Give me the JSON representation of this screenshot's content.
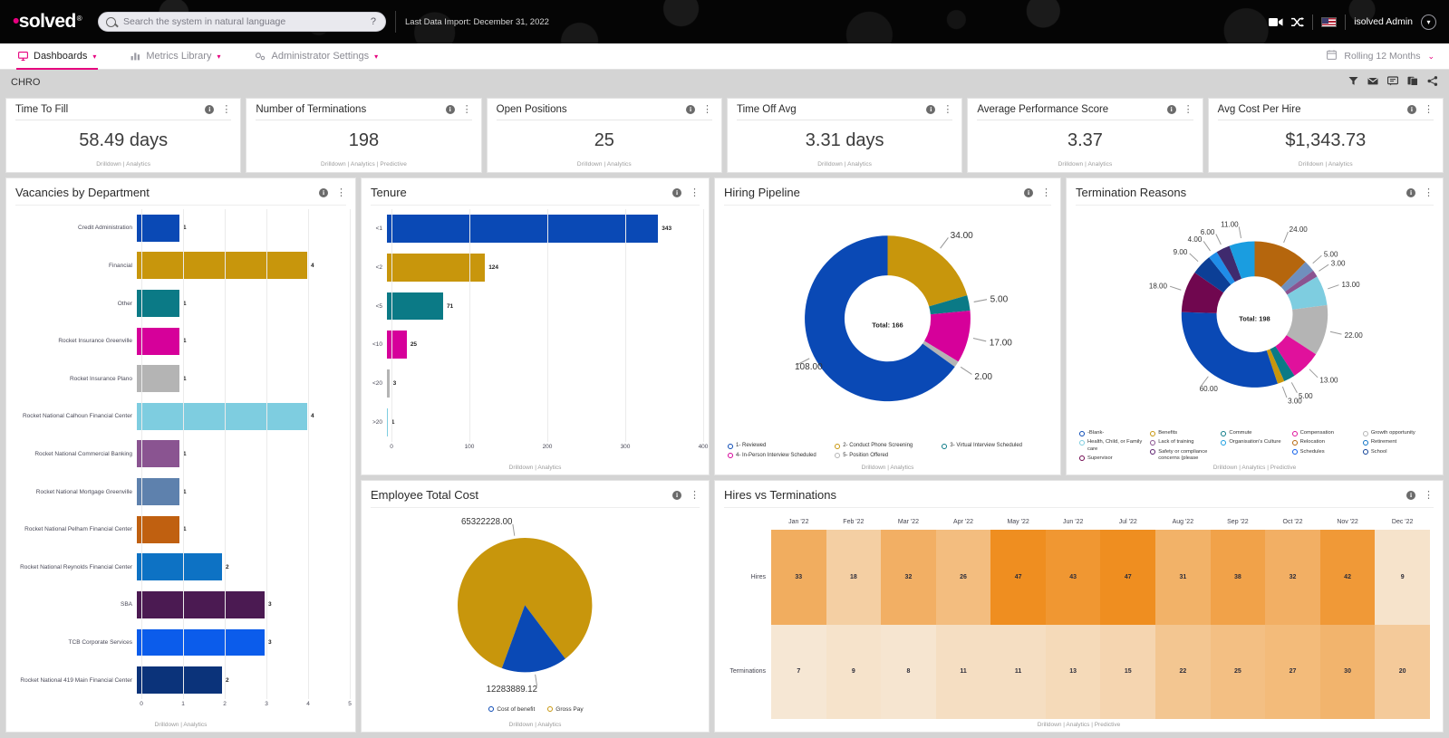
{
  "topbar": {
    "logo_text": "solved",
    "search_placeholder": "Search the system in natural language",
    "search_value": "",
    "help_glyph": "?",
    "last_import": "Last Data Import: December 31, 2022",
    "admin_label": "isolved Admin"
  },
  "nav": {
    "items": [
      {
        "label": "Dashboards",
        "icon": "monitor-icon",
        "active": true
      },
      {
        "label": "Metrics Library",
        "icon": "bar-chart-icon",
        "active": false
      },
      {
        "label": "Administrator Settings",
        "icon": "gears-icon",
        "active": false
      }
    ],
    "date_range": "Rolling 12 Months",
    "date_icon": "calendar-icon"
  },
  "dashboard": {
    "name": "CHRO",
    "toolbar_icons": [
      "filter-icon",
      "mail-icon",
      "comment-icon",
      "copy-icon",
      "share-icon"
    ]
  },
  "kpi_footer": {
    "drilldown": "Drilldown",
    "analytics": "Analytics",
    "predictive": "Predictive"
  },
  "kpis": [
    {
      "title": "Time To Fill",
      "value": "58.49 days",
      "links": "Drilldown | Analytics"
    },
    {
      "title": "Number of Terminations",
      "value": "198",
      "links": "Drilldown | Analytics | Predictive"
    },
    {
      "title": "Open Positions",
      "value": "25",
      "links": "Drilldown | Analytics"
    },
    {
      "title": "Time Off Avg",
      "value": "3.31 days",
      "links": "Drilldown | Analytics"
    },
    {
      "title": "Average Performance Score",
      "value": "3.37",
      "links": "Drilldown | Analytics"
    },
    {
      "title": "Avg Cost Per Hire",
      "value": "$1,343.73",
      "links": "Drilldown | Analytics"
    }
  ],
  "panels": {
    "vacancies": {
      "title": "Vacancies by Department",
      "links": "Drilldown | Analytics"
    },
    "tenure": {
      "title": "Tenure",
      "links": "Drilldown | Analytics"
    },
    "pipeline": {
      "title": "Hiring Pipeline",
      "links": "Drilldown | Analytics"
    },
    "terminations": {
      "title": "Termination Reasons",
      "links": "Drilldown | Analytics | Predictive"
    },
    "cost": {
      "title": "Employee Total Cost",
      "links": "Drilldown | Analytics"
    },
    "hires": {
      "title": "Hires vs Terminations",
      "links": "Drilldown | Analytics | Predictive"
    }
  },
  "chart_data": [
    {
      "type": "bar",
      "id": "vacancies-by-department",
      "title": "Vacancies by Department",
      "orientation": "horizontal",
      "categories": [
        "Credit Administration",
        "Financial",
        "Other",
        "Rocket Insurance Greenville",
        "Rocket Insurance Plano",
        "Rocket National Calhoun Financial Center",
        "Rocket National Commercial Banking",
        "Rocket National Mortgage Greenville",
        "Rocket National Pelham Financial Center",
        "Rocket National Reynolds Financial Center",
        "SBA",
        "TCB Corporate Services",
        "Rocket National 419 Main Financial Center"
      ],
      "values": [
        1,
        4,
        1,
        1,
        1,
        4,
        1,
        1,
        1,
        2,
        3,
        3,
        2
      ],
      "colors": [
        "#0a49b5",
        "#c8960c",
        "#0b7a86",
        "#d6009a",
        "#b4b4b4",
        "#7ecde0",
        "#8a5491",
        "#5e81ad",
        "#c06010",
        "#0d72c4",
        "#4b1a52",
        "#0b5ceb",
        "#0b337a"
      ],
      "xlabel": "",
      "ylabel": "",
      "xticks": [
        0,
        1,
        2,
        3,
        4,
        5
      ],
      "xlim": [
        0,
        5
      ],
      "grid": true
    },
    {
      "type": "bar",
      "id": "tenure",
      "title": "Tenure",
      "orientation": "horizontal",
      "categories": [
        "<1",
        "<2",
        "<5",
        "<10",
        "<20",
        ">20"
      ],
      "values": [
        343,
        124,
        71,
        25,
        3,
        1
      ],
      "colors": [
        "#0a49b5",
        "#c8960c",
        "#0b7a86",
        "#d6009a",
        "#b4b4b4",
        "#7ecde0"
      ],
      "xticks": [
        0,
        100,
        200,
        300,
        400
      ],
      "xlim": [
        0,
        400
      ],
      "grid": true
    },
    {
      "type": "pie",
      "variant": "donut",
      "id": "hiring-pipeline",
      "title": "Hiring Pipeline",
      "center_label": "Total: 166",
      "total": 166,
      "labels": [
        "1- Reviewed",
        "2- Conduct Phone Screening",
        "3- Virtual Interview Scheduled",
        "4- In-Person Interview Scheduled",
        "5- Position Offered"
      ],
      "values": [
        108.0,
        34.0,
        5.0,
        17.0,
        2.0
      ],
      "value_labels": [
        "108.00",
        "34.00",
        "5.00",
        "17.00",
        "2.00"
      ],
      "colors": [
        "#0a49b5",
        "#c8960c",
        "#0b7a86",
        "#d6009a",
        "#b4b4b4"
      ],
      "legend_position": "bottom"
    },
    {
      "type": "pie",
      "variant": "donut",
      "id": "termination-reasons",
      "title": "Termination Reasons",
      "center_label": "Total: 198",
      "total": 198,
      "labels": [
        "-Blank-",
        "Benefits",
        "Commute",
        "Compensation",
        "Growth opportunity",
        "Health, Child, or Family care",
        "Lack of training",
        "Organisation's Culture",
        "Relocation",
        "Retirement",
        "Safety or compliance concerns (please specify)",
        "Schedules",
        "School",
        "Supervisor"
      ],
      "values": [
        24,
        5,
        3,
        13,
        22,
        13,
        5,
        3,
        60,
        18,
        9,
        4,
        6,
        11
      ],
      "value_labels": [
        "24.00",
        "5.00",
        "3.00",
        "13.00",
        "22.00",
        "13.00",
        "5.00",
        "3.00",
        "60.00",
        "18.00",
        "9.00",
        "4.00",
        "6.00",
        "11.00"
      ],
      "colors": [
        "#b5660d",
        "#6f8fbd",
        "#8a5491",
        "#7ecde0",
        "#b4b4b4",
        "#e0119c",
        "#0b7a86",
        "#c8960c",
        "#0a49b5",
        "#70074f",
        "#0c3f96",
        "#1f8de8",
        "#3f2a6e",
        "#1a9de0"
      ],
      "legend_position": "bottom"
    },
    {
      "type": "pie",
      "id": "employee-total-cost",
      "title": "Employee Total Cost",
      "labels": [
        "Cost of benefit",
        "Gross Pay"
      ],
      "values": [
        12283889.12,
        65322228.0
      ],
      "value_labels": [
        "12283889.12",
        "65322228.00"
      ],
      "colors": [
        "#0a49b5",
        "#c8960c"
      ],
      "legend_position": "bottom"
    },
    {
      "type": "heatmap",
      "id": "hires-vs-terminations",
      "title": "Hires vs Terminations",
      "columns": [
        "Jan '22",
        "Feb '22",
        "Mar '22",
        "Apr '22",
        "May '22",
        "Jun '22",
        "Jul '22",
        "Aug '22",
        "Sep '22",
        "Oct '22",
        "Nov '22",
        "Dec '22"
      ],
      "rows": [
        "Hires",
        "Terminations"
      ],
      "series": [
        {
          "name": "Hires",
          "values": [
            33,
            18,
            32,
            26,
            47,
            43,
            47,
            31,
            38,
            32,
            42,
            9
          ]
        },
        {
          "name": "Terminations",
          "values": [
            7,
            9,
            8,
            11,
            11,
            13,
            15,
            22,
            25,
            27,
            30,
            20
          ]
        }
      ],
      "colormap_low": "#f6e7d4",
      "colormap_high": "#ef8e20"
    }
  ],
  "legends": {
    "pipeline": [
      {
        "label": "1- Reviewed",
        "color": "#0a49b5"
      },
      {
        "label": "2- Conduct Phone Screening",
        "color": "#c8960c"
      },
      {
        "label": "3- Virtual Interview Scheduled",
        "color": "#0b7a86"
      },
      {
        "label": "4- In-Person Interview Scheduled",
        "color": "#d6009a"
      },
      {
        "label": "5- Position Offered",
        "color": "#b4b4b4"
      }
    ],
    "terminations": [
      [
        {
          "label": "-Blank-",
          "color": "#0a49b5"
        },
        {
          "label": "Health, Child, or Family care",
          "color": "#7ecde0"
        },
        {
          "label": "Supervisor",
          "color": "#70074f"
        }
      ],
      [
        {
          "label": "Benefits",
          "color": "#c8960c"
        },
        {
          "label": "Lack of training",
          "color": "#8a5491"
        },
        {
          "label": "Safety or compliance concerns (please",
          "color": "#5b1f6e"
        }
      ],
      [
        {
          "label": "Commute",
          "color": "#0b7a86"
        },
        {
          "label": "Organisation's Culture",
          "color": "#1a9de0"
        }
      ],
      [
        {
          "label": "Compensation",
          "color": "#e0119c"
        },
        {
          "label": "Relocation",
          "color": "#b5660d"
        },
        {
          "label": "Schedules",
          "color": "#0b5ceb"
        }
      ],
      [
        {
          "label": "Growth opportunity",
          "color": "#b4b4b4"
        },
        {
          "label": "Retirement",
          "color": "#0d72c4"
        },
        {
          "label": "School",
          "color": "#0c3f96"
        }
      ]
    ],
    "cost": [
      {
        "label": "Cost of benefit",
        "color": "#0a49b5"
      },
      {
        "label": "Gross Pay",
        "color": "#c8960c"
      }
    ]
  }
}
